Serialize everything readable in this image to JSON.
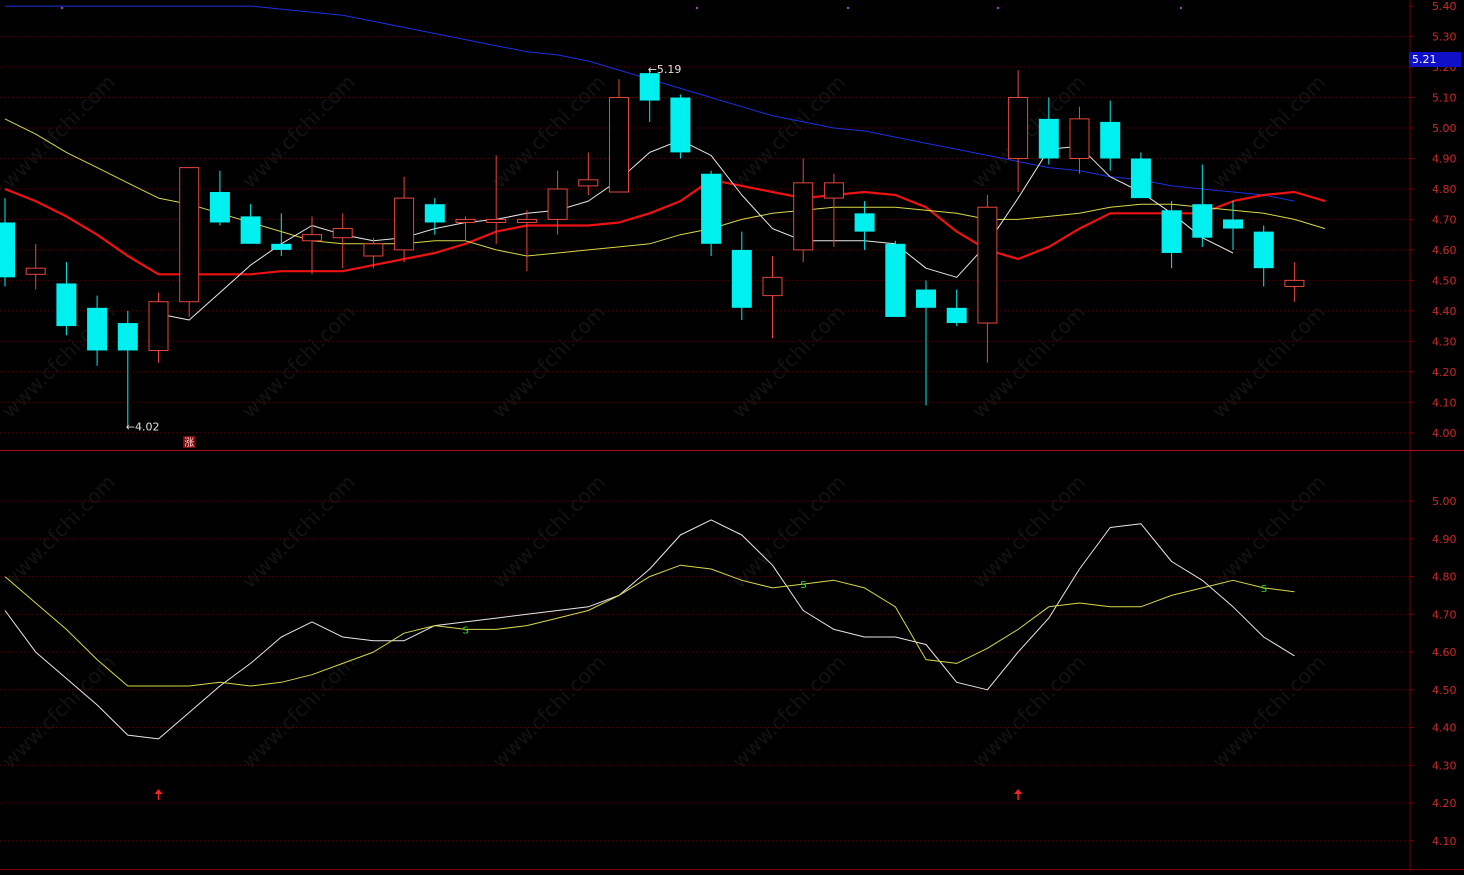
{
  "price_tag": "5.21",
  "colors": {
    "background": "#000000",
    "up": "#e8453c",
    "down": "#00f0f0",
    "ma_short": "#e8e8e8",
    "ma_red": "#ee1111",
    "ma_yellow": "#d8d848",
    "ma_blue": "#1c30e0",
    "grid": "#5a0000",
    "axis_text": "#d02828",
    "frame": "#7a0000",
    "label": "#e0e0e0"
  },
  "markers": {
    "low_label": "4.02",
    "high_label": "5.19",
    "badge": "涨",
    "signal_char": "S"
  },
  "chart_data": [
    {
      "type": "candlestick",
      "name": "main",
      "ylim": [
        3.95,
        5.42
      ],
      "yticks": [
        "5.40",
        "5.30",
        "5.20",
        "5.10",
        "5.00",
        "4.90",
        "4.80",
        "4.70",
        "4.60",
        "4.50",
        "4.40",
        "4.30",
        "4.20",
        "4.10",
        "4.00"
      ],
      "candles": [
        {
          "o": 4.69,
          "h": 4.77,
          "l": 4.48,
          "c": 4.51
        },
        {
          "o": 4.52,
          "h": 4.62,
          "l": 4.47,
          "c": 4.54
        },
        {
          "o": 4.49,
          "h": 4.56,
          "l": 4.32,
          "c": 4.35
        },
        {
          "o": 4.41,
          "h": 4.45,
          "l": 4.22,
          "c": 4.27
        },
        {
          "o": 4.36,
          "h": 4.4,
          "l": 4.02,
          "c": 4.27
        },
        {
          "o": 4.27,
          "h": 4.46,
          "l": 4.23,
          "c": 4.43
        },
        {
          "o": 4.43,
          "h": 4.87,
          "l": 4.38,
          "c": 4.87
        },
        {
          "o": 4.79,
          "h": 4.86,
          "l": 4.68,
          "c": 4.69
        },
        {
          "o": 4.71,
          "h": 4.75,
          "l": 4.62,
          "c": 4.62
        },
        {
          "o": 4.62,
          "h": 4.72,
          "l": 4.58,
          "c": 4.6
        },
        {
          "o": 4.63,
          "h": 4.71,
          "l": 4.52,
          "c": 4.65
        },
        {
          "o": 4.64,
          "h": 4.72,
          "l": 4.54,
          "c": 4.67
        },
        {
          "o": 4.58,
          "h": 4.64,
          "l": 4.54,
          "c": 4.62
        },
        {
          "o": 4.6,
          "h": 4.84,
          "l": 4.56,
          "c": 4.77
        },
        {
          "o": 4.75,
          "h": 4.77,
          "l": 4.65,
          "c": 4.69
        },
        {
          "o": 4.69,
          "h": 4.71,
          "l": 4.63,
          "c": 4.7
        },
        {
          "o": 4.69,
          "h": 4.91,
          "l": 4.62,
          "c": 4.7
        },
        {
          "o": 4.69,
          "h": 4.73,
          "l": 4.53,
          "c": 4.7
        },
        {
          "o": 4.7,
          "h": 4.86,
          "l": 4.65,
          "c": 4.8
        },
        {
          "o": 4.81,
          "h": 4.92,
          "l": 4.78,
          "c": 4.83
        },
        {
          "o": 4.79,
          "h": 5.16,
          "l": 4.79,
          "c": 5.1
        },
        {
          "o": 5.18,
          "h": 5.19,
          "l": 5.02,
          "c": 5.09
        },
        {
          "o": 5.1,
          "h": 5.11,
          "l": 4.9,
          "c": 4.92
        },
        {
          "o": 4.85,
          "h": 4.86,
          "l": 4.58,
          "c": 4.62
        },
        {
          "o": 4.6,
          "h": 4.66,
          "l": 4.37,
          "c": 4.41
        },
        {
          "o": 4.45,
          "h": 4.58,
          "l": 4.31,
          "c": 4.51
        },
        {
          "o": 4.6,
          "h": 4.9,
          "l": 4.56,
          "c": 4.82
        },
        {
          "o": 4.77,
          "h": 4.85,
          "l": 4.61,
          "c": 4.82
        },
        {
          "o": 4.72,
          "h": 4.76,
          "l": 4.6,
          "c": 4.66
        },
        {
          "o": 4.62,
          "h": 4.63,
          "l": 4.38,
          "c": 4.38
        },
        {
          "o": 4.47,
          "h": 4.5,
          "l": 4.09,
          "c": 4.41
        },
        {
          "o": 4.41,
          "h": 4.47,
          "l": 4.35,
          "c": 4.36
        },
        {
          "o": 4.36,
          "h": 4.78,
          "l": 4.23,
          "c": 4.74
        },
        {
          "o": 4.9,
          "h": 5.19,
          "l": 4.79,
          "c": 5.1
        },
        {
          "o": 5.03,
          "h": 5.1,
          "l": 4.88,
          "c": 4.9
        },
        {
          "o": 4.9,
          "h": 5.07,
          "l": 4.85,
          "c": 5.03
        },
        {
          "o": 5.02,
          "h": 5.09,
          "l": 4.86,
          "c": 4.9
        },
        {
          "o": 4.9,
          "h": 4.92,
          "l": 4.77,
          "c": 4.77
        },
        {
          "o": 4.73,
          "h": 4.76,
          "l": 4.54,
          "c": 4.59
        },
        {
          "o": 4.75,
          "h": 4.88,
          "l": 4.61,
          "c": 4.64
        },
        {
          "o": 4.7,
          "h": 4.76,
          "l": 4.6,
          "c": 4.67
        },
        {
          "o": 4.66,
          "h": 4.68,
          "l": 4.48,
          "c": 4.54
        },
        {
          "o": 4.48,
          "h": 4.56,
          "l": 4.43,
          "c": 4.5
        }
      ],
      "series": [
        {
          "color_key": "ma_blue",
          "values": [
            5.4,
            5.4,
            5.4,
            5.4,
            5.4,
            5.4,
            5.4,
            5.4,
            5.4,
            5.39,
            5.38,
            5.37,
            5.35,
            5.33,
            5.31,
            5.29,
            5.27,
            5.25,
            5.24,
            5.22,
            5.19,
            5.16,
            5.13,
            5.1,
            5.07,
            5.04,
            5.02,
            5.0,
            4.99,
            4.97,
            4.95,
            4.93,
            4.91,
            4.89,
            4.87,
            4.86,
            4.84,
            4.83,
            4.81,
            4.8,
            4.79,
            4.78,
            4.76
          ]
        },
        {
          "color_key": "ma_red",
          "values": [
            4.8,
            4.76,
            4.71,
            4.65,
            4.58,
            4.52,
            4.52,
            4.52,
            4.52,
            4.53,
            4.53,
            4.53,
            4.55,
            4.57,
            4.59,
            4.62,
            4.66,
            4.68,
            4.68,
            4.68,
            4.69,
            4.72,
            4.76,
            4.83,
            4.81,
            4.79,
            4.77,
            4.78,
            4.79,
            4.78,
            4.74,
            4.66,
            4.6,
            4.57,
            4.61,
            4.67,
            4.72,
            4.72,
            4.72,
            4.72,
            4.76,
            4.78,
            4.79,
            4.76
          ]
        },
        {
          "color_key": "ma_yellow",
          "values": [
            5.03,
            4.98,
            4.92,
            4.87,
            4.82,
            4.77,
            4.75,
            4.72,
            4.69,
            4.66,
            4.63,
            4.62,
            4.62,
            4.62,
            4.63,
            4.63,
            4.6,
            4.58,
            4.59,
            4.6,
            4.61,
            4.62,
            4.65,
            4.67,
            4.7,
            4.72,
            4.73,
            4.74,
            4.74,
            4.74,
            4.73,
            4.72,
            4.7,
            4.7,
            4.71,
            4.72,
            4.74,
            4.75,
            4.75,
            4.74,
            4.73,
            4.72,
            4.7,
            4.67
          ]
        },
        {
          "color_key": "ma_short",
          "values": [
            null,
            null,
            null,
            null,
            null,
            4.39,
            4.37,
            4.46,
            4.55,
            4.62,
            4.68,
            4.65,
            4.63,
            4.64,
            4.67,
            4.69,
            4.7,
            4.72,
            4.73,
            4.76,
            4.83,
            4.92,
            4.96,
            4.91,
            4.78,
            4.67,
            4.63,
            4.63,
            4.63,
            4.62,
            4.54,
            4.51,
            4.62,
            4.77,
            4.93,
            4.94,
            4.84,
            4.79,
            4.72,
            4.64,
            4.59
          ]
        }
      ]
    },
    {
      "type": "line",
      "name": "indicator",
      "ylim": [
        4.02,
        5.13
      ],
      "yticks": [
        "5.00",
        "4.90",
        "4.80",
        "4.70",
        "4.60",
        "4.50",
        "4.40",
        "4.30",
        "4.20",
        "4.10"
      ],
      "series": [
        {
          "color_key": "ma_short",
          "values": [
            4.71,
            4.6,
            4.53,
            4.46,
            4.38,
            4.37,
            4.44,
            4.51,
            4.57,
            4.64,
            4.68,
            4.64,
            4.63,
            4.63,
            4.67,
            4.68,
            4.69,
            4.7,
            4.71,
            4.72,
            4.75,
            4.82,
            4.91,
            4.95,
            4.91,
            4.83,
            4.71,
            4.66,
            4.64,
            4.64,
            4.62,
            4.52,
            4.5,
            4.6,
            4.69,
            4.82,
            4.93,
            4.94,
            4.84,
            4.79,
            4.72,
            4.64,
            4.59
          ]
        },
        {
          "color_key": "ma_yellow",
          "values": [
            4.8,
            4.73,
            4.66,
            4.58,
            4.51,
            4.51,
            4.51,
            4.52,
            4.51,
            4.52,
            4.54,
            4.57,
            4.6,
            4.65,
            4.67,
            4.66,
            4.66,
            4.67,
            4.69,
            4.71,
            4.75,
            4.8,
            4.83,
            4.82,
            4.79,
            4.77,
            4.78,
            4.79,
            4.77,
            4.72,
            4.58,
            4.57,
            4.61,
            4.66,
            4.72,
            4.73,
            4.72,
            4.72,
            4.75,
            4.77,
            4.79,
            4.77,
            4.76
          ]
        },
        {
          "values": []
        }
      ],
      "signals": [
        {
          "index": 15
        },
        {
          "index": 26
        },
        {
          "index": 41
        }
      ],
      "arrows": [
        {
          "index": 5
        },
        {
          "index": 33
        }
      ]
    }
  ]
}
